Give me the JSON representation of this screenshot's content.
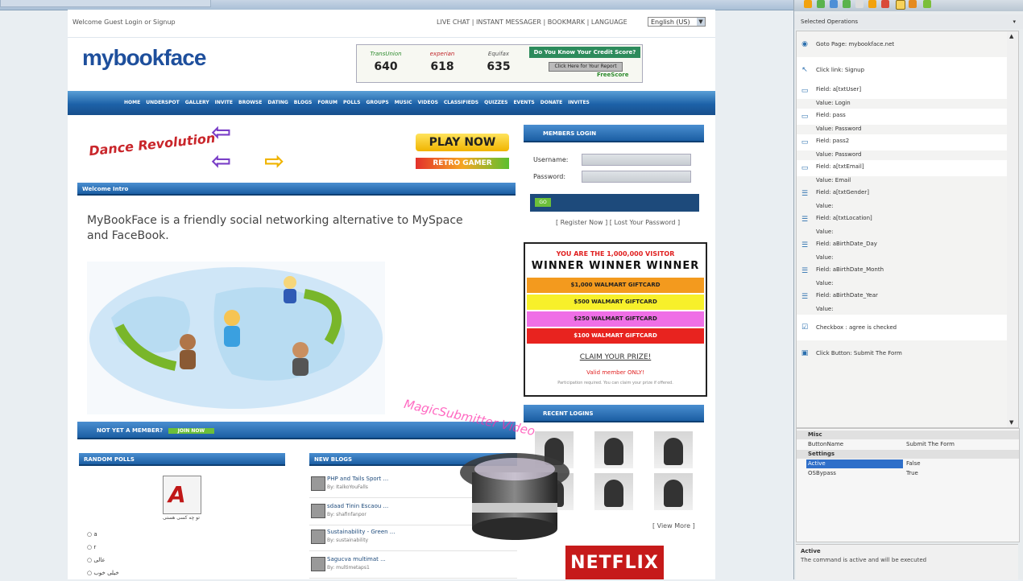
{
  "page": {
    "welcome": "Welcome Guest Login or Signup",
    "top_links": "LIVE CHAT  |  INSTANT MESSAGER  |  BOOKMARK  |  LANGUAGE",
    "language_value": "English (US)",
    "logo": "mybookface",
    "credit": {
      "scores": [
        {
          "label": "TransUnion",
          "value": "640"
        },
        {
          "label": "experian",
          "value": "618"
        },
        {
          "label": "Equifax",
          "value": "635"
        }
      ],
      "title": "Do You Know Your Credit Score?",
      "button": "Click Here for Your Report",
      "brand": "FreeScore"
    },
    "nav": [
      "HOME",
      "UNDERSPOT",
      "GALLERY",
      "INVITE",
      "BROWSE",
      "DATING",
      "BLOGS",
      "FORUM",
      "POLLS",
      "GROUPS",
      "MUSIC",
      "VIDEOS",
      "CLASSIFIEDS",
      "QUIZZES",
      "EVENTS",
      "DONATE",
      "INVITES"
    ],
    "ddr_logo": "Dance Revolution",
    "play_now": "PLAY NOW",
    "retro": "RETRO GAMER",
    "welcome_bar": "Welcome Intro",
    "intro": "MyBookFace is a friendly social networking alternative to MySpace and FaceBook.",
    "not_member_bar": "NOT YET A MEMBER?",
    "join_now": "JOIN NOW",
    "members_login_bar": "MEMBERS LOGIN",
    "username_label": "Username:",
    "password_label": "Password:",
    "login_go": "GO",
    "reg_links": "[ Register Now ]   [ Lost Your Password ]",
    "prize": {
      "top": "YOU ARE THE 1,000,000 VISITOR",
      "winner": "WINNER   WINNER   WINNER",
      "rows": [
        {
          "label": "$1,000 WALMART GIFTCARD",
          "color": "#f39a1e"
        },
        {
          "label": "$500 WALMART GIFTCARD",
          "color": "#f7f02a"
        },
        {
          "label": "$250 WALMART GIFTCARD",
          "color": "#ef6fe6"
        },
        {
          "label": "$100 WALMART GIFTCARD",
          "color": "#e8231f"
        }
      ],
      "claim": "CLAIM YOUR PRIZE!",
      "claim_sub": "Valid member ONLY!",
      "fine": "Participation required. You can claim your prize if offered."
    },
    "recent_logins_bar": "RECENT LOGINS",
    "view_more": "[ View More ]",
    "netflix": "NETFLIX",
    "random_polls_bar": "RANDOM POLLS",
    "new_blogs_bar": "NEW BLOGS",
    "poll_caption": "تو چه کسی هستی",
    "poll_options": [
      "a",
      "r",
      "عالی",
      "خیلی خوب"
    ],
    "blogs": [
      {
        "title": "PHP and Tails Sport ...",
        "by": "By: ItalkoYouFalls"
      },
      {
        "title": "sdaad Tinin Escaou ...",
        "by": "By: shafinfanpor"
      },
      {
        "title": "Sustainability - Green ...",
        "by": "By: sustainability"
      },
      {
        "title": "Sagucva multimat ...",
        "by": "By: multimetaps1"
      }
    ],
    "watermark": "MagicSubmitter Video"
  },
  "panel": {
    "title": "Selected Operations",
    "ops": [
      {
        "icon": "globe",
        "text": "Goto Page: mybookface.net"
      },
      {
        "icon": "pointer",
        "text": "Click link: Signup"
      },
      {
        "icon": "field",
        "text": "Field: a[txtUser]"
      },
      {
        "icon": "",
        "text": "Value: Login"
      },
      {
        "icon": "field",
        "text": "Field: pass"
      },
      {
        "icon": "",
        "text": "Value: Password"
      },
      {
        "icon": "field",
        "text": "Field: pass2"
      },
      {
        "icon": "",
        "text": "Value: Password"
      },
      {
        "icon": "field",
        "text": "Field: a[txtEmail]"
      },
      {
        "icon": "",
        "text": "Value: Email"
      },
      {
        "icon": "list",
        "text": "Field: a[txtGender]"
      },
      {
        "icon": "",
        "text": "Value:"
      },
      {
        "icon": "list",
        "text": "Field: a[txtLocation]"
      },
      {
        "icon": "",
        "text": "Value:"
      },
      {
        "icon": "list",
        "text": "Field: aBirthDate_Day"
      },
      {
        "icon": "",
        "text": "Value:"
      },
      {
        "icon": "list",
        "text": "Field: aBirthDate_Month"
      },
      {
        "icon": "",
        "text": "Value:"
      },
      {
        "icon": "list",
        "text": "Field: aBirthDate_Year"
      },
      {
        "icon": "",
        "text": "Value:"
      },
      {
        "icon": "check",
        "text": "Checkbox : agree is checked"
      },
      {
        "icon": "button",
        "text": "Click Button: Submit The Form"
      }
    ],
    "props": [
      {
        "k": "Misc",
        "v": "",
        "group": true
      },
      {
        "k": "ButtonName",
        "v": "Submit The Form"
      },
      {
        "k": "Settings",
        "v": "",
        "group": true
      },
      {
        "k": "Active",
        "v": "False",
        "sel": true
      },
      {
        "k": "OSBypass",
        "v": "True"
      }
    ],
    "desc_title": "Active",
    "desc_text": "The command is active and will be executed"
  }
}
